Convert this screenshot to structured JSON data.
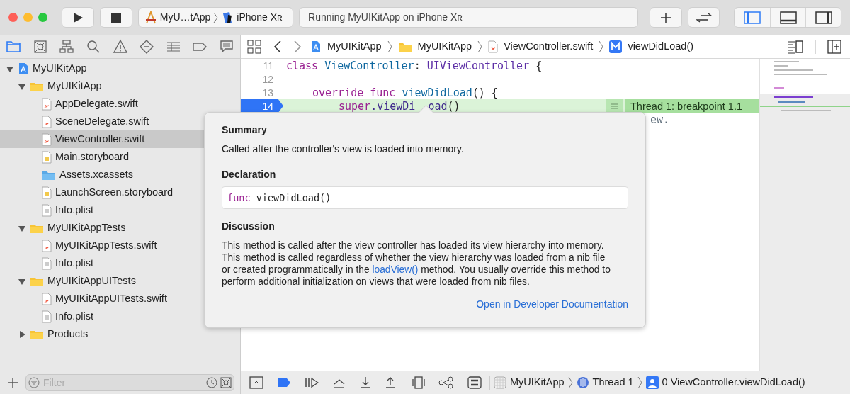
{
  "toolbar": {
    "scheme": "MyU…tApp",
    "destination": "iPhone Xʀ",
    "status": "Running MyUIKitApp on iPhone Xʀ",
    "panels": [
      {
        "kind": "left",
        "selected": true
      },
      {
        "kind": "bottom",
        "selected": false
      },
      {
        "kind": "right",
        "selected": false
      }
    ]
  },
  "navigator_tabs": [
    {
      "kind": "folder",
      "selected": true
    },
    {
      "kind": "source",
      "selected": false
    },
    {
      "kind": "hierarchy",
      "selected": false
    },
    {
      "kind": "search",
      "selected": false
    },
    {
      "kind": "warning",
      "selected": false
    },
    {
      "kind": "test",
      "selected": false
    },
    {
      "kind": "debug",
      "selected": false
    },
    {
      "kind": "breakpoint",
      "selected": false
    },
    {
      "kind": "report",
      "selected": false
    }
  ],
  "tree": [
    {
      "label": "MyUIKitApp",
      "kind": "project",
      "expanded": true,
      "selected": false,
      "children": [
        {
          "label": "MyUIKitApp",
          "kind": "folder",
          "expanded": true,
          "selected": false,
          "children": [
            {
              "label": "AppDelegate.swift",
              "kind": "swift",
              "selected": false
            },
            {
              "label": "SceneDelegate.swift",
              "kind": "swift",
              "selected": false
            },
            {
              "label": "ViewController.swift",
              "kind": "swift",
              "selected": true
            },
            {
              "label": "Main.storyboard",
              "kind": "storyboard",
              "selected": false
            },
            {
              "label": "Assets.xcassets",
              "kind": "assets",
              "selected": false
            },
            {
              "label": "LaunchScreen.storyboard",
              "kind": "storyboard",
              "selected": false
            },
            {
              "label": "Info.plist",
              "kind": "plist",
              "selected": false
            }
          ]
        },
        {
          "label": "MyUIKitAppTests",
          "kind": "folder",
          "expanded": true,
          "selected": false,
          "children": [
            {
              "label": "MyUIKitAppTests.swift",
              "kind": "swift",
              "selected": false
            },
            {
              "label": "Info.plist",
              "kind": "plist",
              "selected": false
            }
          ]
        },
        {
          "label": "MyUIKitAppUITests",
          "kind": "folder",
          "expanded": true,
          "selected": false,
          "children": [
            {
              "label": "MyUIKitAppUITests.swift",
              "kind": "swift",
              "selected": false
            },
            {
              "label": "Info.plist",
              "kind": "plist",
              "selected": false
            }
          ]
        },
        {
          "label": "Products",
          "kind": "folder",
          "expanded": false,
          "selected": false
        }
      ]
    }
  ],
  "filter": {
    "placeholder": "Filter"
  },
  "jump_bar": [
    {
      "label": "MyUIKitApp",
      "kind": "project"
    },
    {
      "label": "MyUIKitApp",
      "kind": "folder"
    },
    {
      "label": "ViewController.swift",
      "kind": "swift"
    },
    {
      "label": "viewDidLoad()",
      "kind": "method"
    }
  ],
  "code": {
    "lines": [
      {
        "number": "11",
        "kind": "top",
        "current": false,
        "segments": [
          {
            "text": "class ",
            "kind": "keyword"
          },
          {
            "text": "ViewController",
            "kind": "declaration"
          },
          {
            "text": ": ",
            "kind": "plain"
          },
          {
            "text": "UIViewController",
            "kind": "type"
          },
          {
            "text": " {",
            "kind": "plain"
          }
        ]
      },
      {
        "number": "12",
        "kind": "top",
        "current": false
      },
      {
        "number": "13",
        "kind": "member",
        "current": false,
        "segments": [
          {
            "text": "override func ",
            "kind": "keyword"
          },
          {
            "text": "viewDidLoad",
            "kind": "declaration"
          },
          {
            "text": "() {",
            "kind": "plain"
          }
        ]
      },
      {
        "number": "14",
        "kind": "body",
        "current": true,
        "segments": [
          {
            "text": "super",
            "kind": "keyword"
          },
          {
            "text": ".viewDi",
            "kind": "call"
          },
          {
            "kind": "gap"
          },
          {
            "text": "oad",
            "kind": "call"
          },
          {
            "text": "()",
            "kind": "plain"
          }
        ]
      },
      {
        "kind": "tail",
        "current": false,
        "segments": [
          {
            "text": "ew.",
            "kind": "comment"
          }
        ]
      }
    ],
    "thread_label": "Thread 1: breakpoint 1.1"
  },
  "popover": {
    "summary_heading": "Summary",
    "summary": "Called after the controller's view is loaded into memory.",
    "declaration_heading": "Declaration",
    "declaration_keyword": "func",
    "declaration_name": "viewDidLoad()",
    "discussion_heading": "Discussion",
    "discussion_before": "This method is called after the view controller has loaded its view hierarchy into memory. This method is called regardless of whether the view hierarchy was loaded from a nib file or created programmatically in the",
    "discussion_link": "loadView()",
    "discussion_after": "method. You usually override this method to perform additional initialization on views that were loaded from nib files.",
    "docs_link": "Open in Developer Documentation"
  },
  "debug_bar": {
    "breakpoints_active": true,
    "path": [
      {
        "label": "MyUIKitApp",
        "kind": "app"
      },
      {
        "label": "Thread 1",
        "kind": "thread"
      },
      {
        "label": "0 ViewController.viewDidLoad()",
        "kind": "frame"
      }
    ]
  }
}
